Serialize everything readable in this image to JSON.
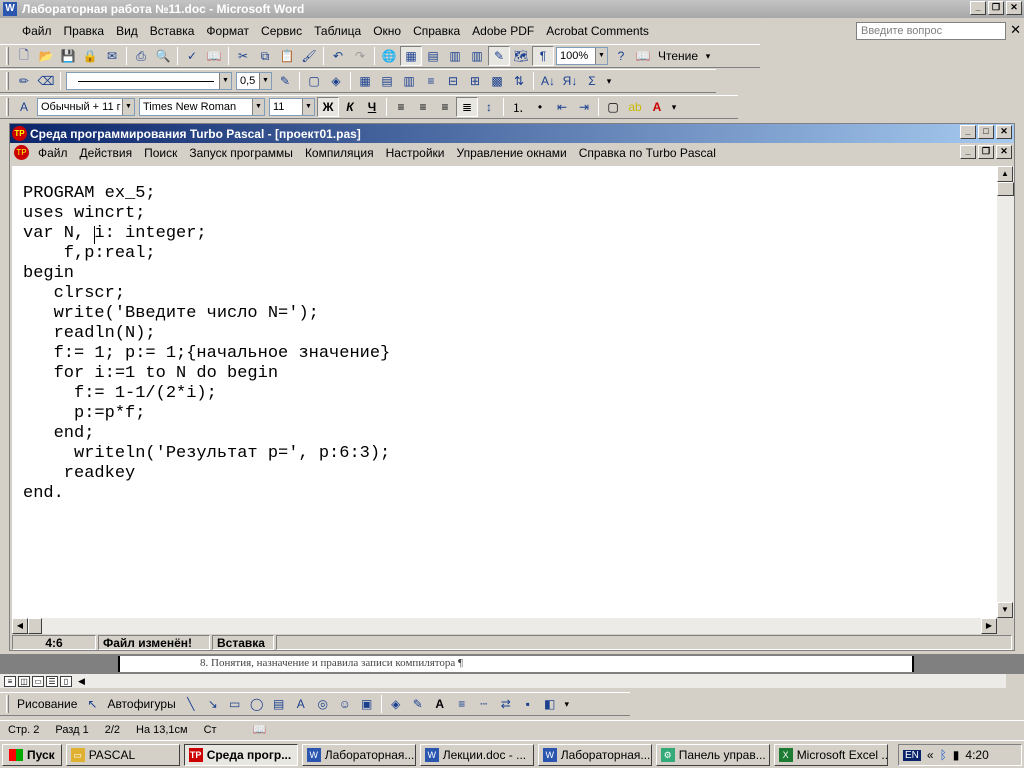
{
  "word": {
    "title": "Лабораторная работа №11.doc - Microsoft Word",
    "menu": [
      "Файл",
      "Правка",
      "Вид",
      "Вставка",
      "Формат",
      "Сервис",
      "Таблица",
      "Окно",
      "Справка",
      "Adobe PDF",
      "Acrobat Comments"
    ],
    "ask_placeholder": "Введите вопрос",
    "zoom": "100%",
    "reading_label": "Чтение",
    "line_weight": "0,5",
    "style": "Обычный + 11 г",
    "font": "Times New Roman",
    "font_size": "11",
    "doc_text": "8. Понятия, назначение и правила записи компилятора ¶",
    "status": {
      "page": "Стр. 2",
      "section": "Разд 1",
      "pages": "2/2",
      "at": "На 13,1см",
      "col": "Ст"
    },
    "drawing": {
      "draw_label": "Рисование",
      "autoshapes_label": "Автофигуры"
    }
  },
  "pascal": {
    "title": "Среда программирования Turbo Pascal - [проект01.pas]",
    "menu": [
      "Файл",
      "Действия",
      "Поиск",
      "Запуск программы",
      "Компиляция",
      "Настройки",
      "Управление окнами",
      "Справка по Turbo Pascal"
    ],
    "code": "PROGRAM ex_5;\nuses wincrt;\nvar N, i: integer;\n    f,p:real;\nbegin\n   clrscr;\n   write('Введите число N=');\n   readln(N);\n   f:= 1; p:= 1;{начальное значение}\n   for i:=1 to N do begin\n     f:= 1-1/(2*i);\n     p:=p*f;\n   end;\n     writeln('Результат p=', p:6:3);\n    readkey\nend.",
    "status": {
      "position": "4:6",
      "modified": "Файл изменён!",
      "mode": "Вставка"
    }
  },
  "taskbar": {
    "start_label": "Пуск",
    "tasks": [
      "PASCAL",
      "Среда прогр...",
      "Лабораторная...",
      "Лекции.doc - ...",
      "Лабораторная...",
      "Панель управ...",
      "Microsoft Excel ..."
    ],
    "lang": "EN",
    "clock": "4:20"
  }
}
